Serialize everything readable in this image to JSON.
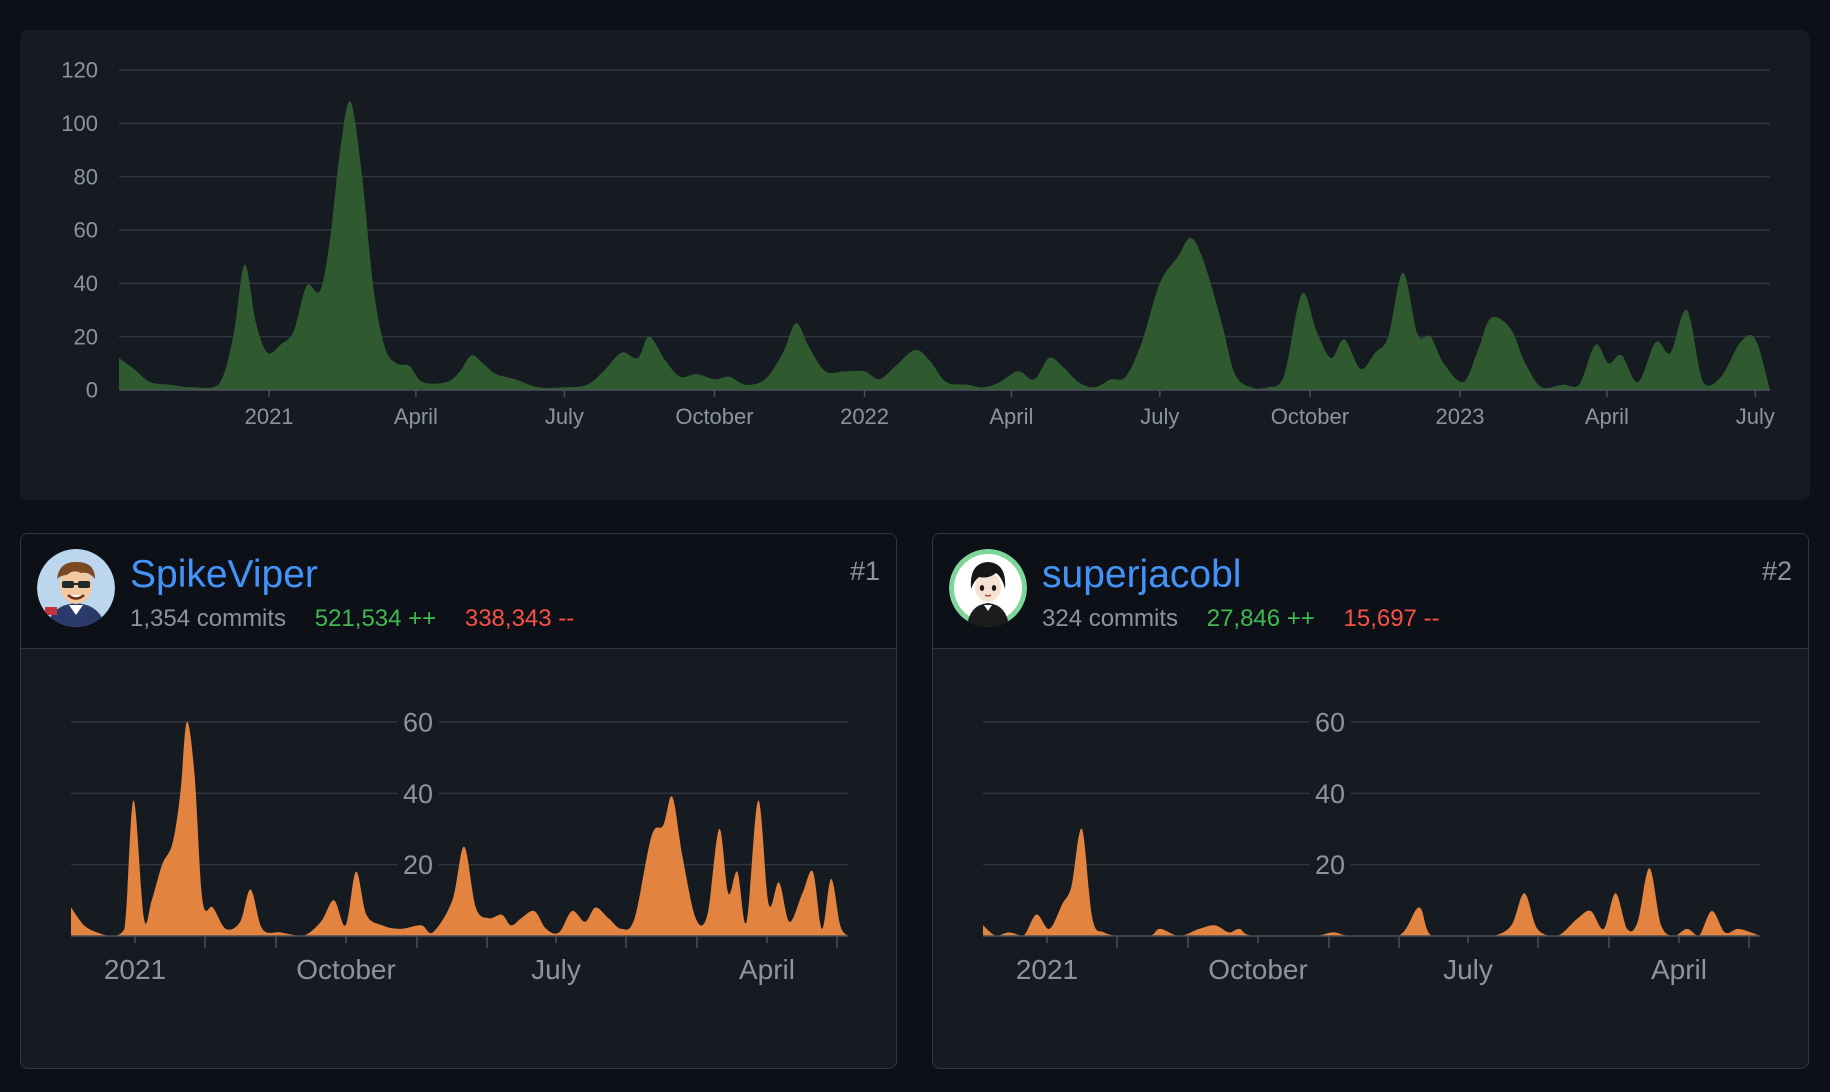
{
  "overview": {
    "chart_data": {
      "type": "area",
      "color": "#2f5a2f",
      "y_ticks": [
        "0",
        "20",
        "40",
        "60",
        "80",
        "100",
        "120"
      ],
      "ylim": [
        0,
        120
      ],
      "x_range": [
        "2020-10-01",
        "2023-07-10"
      ],
      "x_ticks": [
        {
          "label": "2021",
          "date": "2021-01-01"
        },
        {
          "label": "April",
          "date": "2021-04-01"
        },
        {
          "label": "July",
          "date": "2021-07-01"
        },
        {
          "label": "October",
          "date": "2021-10-01"
        },
        {
          "label": "2022",
          "date": "2022-01-01"
        },
        {
          "label": "April",
          "date": "2022-04-01"
        },
        {
          "label": "July",
          "date": "2022-07-01"
        },
        {
          "label": "October",
          "date": "2022-10-01"
        },
        {
          "label": "2023",
          "date": "2023-01-01"
        },
        {
          "label": "April",
          "date": "2023-04-01"
        },
        {
          "label": "July",
          "date": "2023-07-01"
        }
      ],
      "points": [
        [
          "2020-10-01",
          12
        ],
        [
          "2020-10-10",
          8
        ],
        [
          "2020-10-20",
          3
        ],
        [
          "2020-11-01",
          2
        ],
        [
          "2020-11-15",
          1
        ],
        [
          "2020-12-01",
          2
        ],
        [
          "2020-12-10",
          20
        ],
        [
          "2020-12-17",
          47
        ],
        [
          "2020-12-24",
          25
        ],
        [
          "2020-12-31",
          14
        ],
        [
          "2021-01-08",
          17
        ],
        [
          "2021-01-16",
          22
        ],
        [
          "2021-01-24",
          39
        ],
        [
          "2021-02-01",
          37
        ],
        [
          "2021-02-07",
          55
        ],
        [
          "2021-02-14",
          92
        ],
        [
          "2021-02-20",
          108
        ],
        [
          "2021-02-27",
          80
        ],
        [
          "2021-03-06",
          38
        ],
        [
          "2021-03-13",
          16
        ],
        [
          "2021-03-20",
          10
        ],
        [
          "2021-03-28",
          9
        ],
        [
          "2021-04-05",
          3
        ],
        [
          "2021-04-20",
          3
        ],
        [
          "2021-04-28",
          7
        ],
        [
          "2021-05-05",
          13
        ],
        [
          "2021-05-12",
          10
        ],
        [
          "2021-05-20",
          6
        ],
        [
          "2021-06-01",
          4
        ],
        [
          "2021-06-15",
          1
        ],
        [
          "2021-07-01",
          1
        ],
        [
          "2021-07-15",
          2
        ],
        [
          "2021-07-25",
          7
        ],
        [
          "2021-08-05",
          14
        ],
        [
          "2021-08-15",
          12
        ],
        [
          "2021-08-22",
          20
        ],
        [
          "2021-09-01",
          11
        ],
        [
          "2021-09-10",
          5
        ],
        [
          "2021-09-20",
          6
        ],
        [
          "2021-10-01",
          4
        ],
        [
          "2021-10-10",
          5
        ],
        [
          "2021-10-20",
          2
        ],
        [
          "2021-11-01",
          4
        ],
        [
          "2021-11-12",
          14
        ],
        [
          "2021-11-20",
          25
        ],
        [
          "2021-11-28",
          16
        ],
        [
          "2021-12-08",
          7
        ],
        [
          "2021-12-20",
          7
        ],
        [
          "2022-01-01",
          7
        ],
        [
          "2022-01-10",
          4
        ],
        [
          "2022-01-20",
          9
        ],
        [
          "2022-02-01",
          15
        ],
        [
          "2022-02-10",
          11
        ],
        [
          "2022-02-20",
          3
        ],
        [
          "2022-03-05",
          2
        ],
        [
          "2022-03-15",
          1
        ],
        [
          "2022-03-25",
          3
        ],
        [
          "2022-04-05",
          7
        ],
        [
          "2022-04-15",
          4
        ],
        [
          "2022-04-24",
          12
        ],
        [
          "2022-05-02",
          9
        ],
        [
          "2022-05-12",
          3
        ],
        [
          "2022-05-22",
          1
        ],
        [
          "2022-06-01",
          4
        ],
        [
          "2022-06-10",
          5
        ],
        [
          "2022-06-20",
          18
        ],
        [
          "2022-07-01",
          40
        ],
        [
          "2022-07-12",
          50
        ],
        [
          "2022-07-20",
          57
        ],
        [
          "2022-07-28",
          48
        ],
        [
          "2022-08-08",
          25
        ],
        [
          "2022-08-16",
          6
        ],
        [
          "2022-08-26",
          1
        ],
        [
          "2022-09-05",
          1
        ],
        [
          "2022-09-15",
          5
        ],
        [
          "2022-09-26",
          36
        ],
        [
          "2022-10-05",
          22
        ],
        [
          "2022-10-14",
          12
        ],
        [
          "2022-10-22",
          19
        ],
        [
          "2022-11-01",
          8
        ],
        [
          "2022-11-10",
          14
        ],
        [
          "2022-11-18",
          20
        ],
        [
          "2022-11-27",
          44
        ],
        [
          "2022-12-06",
          21
        ],
        [
          "2022-12-14",
          20
        ],
        [
          "2022-12-22",
          10
        ],
        [
          "2023-01-03",
          3
        ],
        [
          "2023-01-12",
          15
        ],
        [
          "2023-01-20",
          27
        ],
        [
          "2023-02-01",
          23
        ],
        [
          "2023-02-10",
          10
        ],
        [
          "2023-02-20",
          1
        ],
        [
          "2023-03-05",
          2
        ],
        [
          "2023-03-15",
          2
        ],
        [
          "2023-03-25",
          17
        ],
        [
          "2023-04-02",
          10
        ],
        [
          "2023-04-10",
          13
        ],
        [
          "2023-04-20",
          3
        ],
        [
          "2023-05-01",
          18
        ],
        [
          "2023-05-10",
          14
        ],
        [
          "2023-05-20",
          30
        ],
        [
          "2023-05-30",
          3
        ],
        [
          "2023-06-10",
          5
        ],
        [
          "2023-06-22",
          18
        ],
        [
          "2023-07-01",
          19
        ],
        [
          "2023-07-10",
          0
        ]
      ]
    }
  },
  "contributors": [
    {
      "name": "SpikeViper",
      "commits": "1,354 commits",
      "additions": "521,534 ++",
      "deletions": "338,343 --",
      "rank": "#1",
      "avatar_icon": "avatar-cartoon-sunglasses-icon",
      "chart_data": {
        "type": "area",
        "color": "#e2833f",
        "y_ticks": [
          "20",
          "40",
          "60"
        ],
        "ylim": [
          0,
          60
        ],
        "x_range": [
          "2020-10-05",
          "2022-05-25"
        ],
        "x_ticks": [
          {
            "label": "2021",
            "date": "2021-01-01"
          },
          {
            "label": "October",
            "date": "2021-10-01"
          },
          {
            "label": "July",
            "date": "2022-07-01"
          },
          {
            "label": "April",
            "date": "2023-04-01"
          }
        ],
        "points": [
          [
            "2020-10-05",
            8
          ],
          [
            "2020-10-15",
            3
          ],
          [
            "2020-10-25",
            1
          ],
          [
            "2020-11-05",
            0
          ],
          [
            "2020-11-15",
            2
          ],
          [
            "2020-11-22",
            38
          ],
          [
            "2020-11-30",
            5
          ],
          [
            "2020-12-06",
            10
          ],
          [
            "2020-12-14",
            20
          ],
          [
            "2020-12-22",
            26
          ],
          [
            "2020-12-28",
            40
          ],
          [
            "2021-01-02",
            60
          ],
          [
            "2021-01-08",
            45
          ],
          [
            "2021-01-14",
            10
          ],
          [
            "2021-01-22",
            8
          ],
          [
            "2021-02-01",
            2
          ],
          [
            "2021-02-12",
            4
          ],
          [
            "2021-02-20",
            13
          ],
          [
            "2021-03-01",
            2
          ],
          [
            "2021-03-15",
            1
          ],
          [
            "2021-04-01",
            0
          ],
          [
            "2021-04-15",
            4
          ],
          [
            "2021-04-25",
            10
          ],
          [
            "2021-05-04",
            3
          ],
          [
            "2021-05-12",
            18
          ],
          [
            "2021-05-20",
            6
          ],
          [
            "2021-06-01",
            3
          ],
          [
            "2021-06-15",
            2
          ],
          [
            "2021-07-01",
            3
          ],
          [
            "2021-07-10",
            1
          ],
          [
            "2021-07-25",
            10
          ],
          [
            "2021-08-03",
            25
          ],
          [
            "2021-08-12",
            8
          ],
          [
            "2021-08-22",
            5
          ],
          [
            "2021-09-01",
            6
          ],
          [
            "2021-09-08",
            3
          ],
          [
            "2021-09-16",
            5
          ],
          [
            "2021-09-26",
            7
          ],
          [
            "2021-10-05",
            2
          ],
          [
            "2021-10-15",
            1
          ],
          [
            "2021-10-25",
            7
          ],
          [
            "2021-11-04",
            4
          ],
          [
            "2021-11-12",
            8
          ],
          [
            "2021-11-22",
            5
          ],
          [
            "2021-12-02",
            2
          ],
          [
            "2021-12-12",
            5
          ],
          [
            "2021-12-25",
            28
          ],
          [
            "2022-01-03",
            31
          ],
          [
            "2022-01-10",
            39
          ],
          [
            "2022-01-18",
            22
          ],
          [
            "2022-01-28",
            5
          ],
          [
            "2022-02-06",
            6
          ],
          [
            "2022-02-15",
            30
          ],
          [
            "2022-02-22",
            12
          ],
          [
            "2022-03-01",
            18
          ],
          [
            "2022-03-08",
            4
          ],
          [
            "2022-03-17",
            38
          ],
          [
            "2022-03-25",
            9
          ],
          [
            "2022-04-02",
            15
          ],
          [
            "2022-04-10",
            4
          ],
          [
            "2022-04-20",
            12
          ],
          [
            "2022-04-28",
            18
          ],
          [
            "2022-05-05",
            2
          ],
          [
            "2022-05-12",
            16
          ],
          [
            "2022-05-19",
            3
          ],
          [
            "2022-05-25",
            0
          ]
        ]
      }
    },
    {
      "name": "superjacobl",
      "commits": "324 commits",
      "additions": "27,846 ++",
      "deletions": "15,697 --",
      "rank": "#2",
      "avatar_icon": "avatar-anime-character-icon",
      "chart_data": {
        "type": "area",
        "color": "#e2833f",
        "y_ticks": [
          "20",
          "40",
          "60"
        ],
        "ylim": [
          0,
          60
        ],
        "x_range": [
          "2020-10-05",
          "2022-05-25"
        ],
        "x_ticks": [
          {
            "label": "2021",
            "date": "2021-01-01"
          },
          {
            "label": "October",
            "date": "2021-10-01"
          },
          {
            "label": "July",
            "date": "2022-07-01"
          },
          {
            "label": "April",
            "date": "2023-04-01"
          }
        ],
        "points": [
          [
            "2020-10-05",
            3
          ],
          [
            "2020-10-15",
            0
          ],
          [
            "2020-10-25",
            1
          ],
          [
            "2020-11-05",
            0
          ],
          [
            "2020-11-15",
            6
          ],
          [
            "2020-11-25",
            2
          ],
          [
            "2020-12-05",
            9
          ],
          [
            "2020-12-12",
            14
          ],
          [
            "2020-12-20",
            30
          ],
          [
            "2020-12-28",
            5
          ],
          [
            "2021-01-06",
            1
          ],
          [
            "2021-01-20",
            0
          ],
          [
            "2021-02-10",
            0
          ],
          [
            "2021-02-18",
            2
          ],
          [
            "2021-03-05",
            0
          ],
          [
            "2021-03-20",
            2
          ],
          [
            "2021-04-01",
            3
          ],
          [
            "2021-04-12",
            1
          ],
          [
            "2021-04-20",
            2
          ],
          [
            "2021-05-01",
            0
          ],
          [
            "2021-06-15",
            0
          ],
          [
            "2021-07-01",
            1
          ],
          [
            "2021-07-15",
            0
          ],
          [
            "2021-08-20",
            0
          ],
          [
            "2021-09-05",
            8
          ],
          [
            "2021-09-15",
            0
          ],
          [
            "2021-10-15",
            0
          ],
          [
            "2021-11-01",
            0
          ],
          [
            "2021-11-15",
            3
          ],
          [
            "2021-11-25",
            12
          ],
          [
            "2021-12-05",
            2
          ],
          [
            "2021-12-20",
            0
          ],
          [
            "2022-01-05",
            5
          ],
          [
            "2022-01-15",
            7
          ],
          [
            "2022-01-25",
            2
          ],
          [
            "2022-02-03",
            12
          ],
          [
            "2022-02-12",
            2
          ],
          [
            "2022-02-20",
            4
          ],
          [
            "2022-03-01",
            19
          ],
          [
            "2022-03-10",
            3
          ],
          [
            "2022-03-20",
            0
          ],
          [
            "2022-03-30",
            2
          ],
          [
            "2022-04-08",
            0
          ],
          [
            "2022-04-18",
            7
          ],
          [
            "2022-04-28",
            1
          ],
          [
            "2022-05-08",
            2
          ],
          [
            "2022-05-18",
            1
          ],
          [
            "2022-05-25",
            0
          ]
        ]
      }
    }
  ]
}
